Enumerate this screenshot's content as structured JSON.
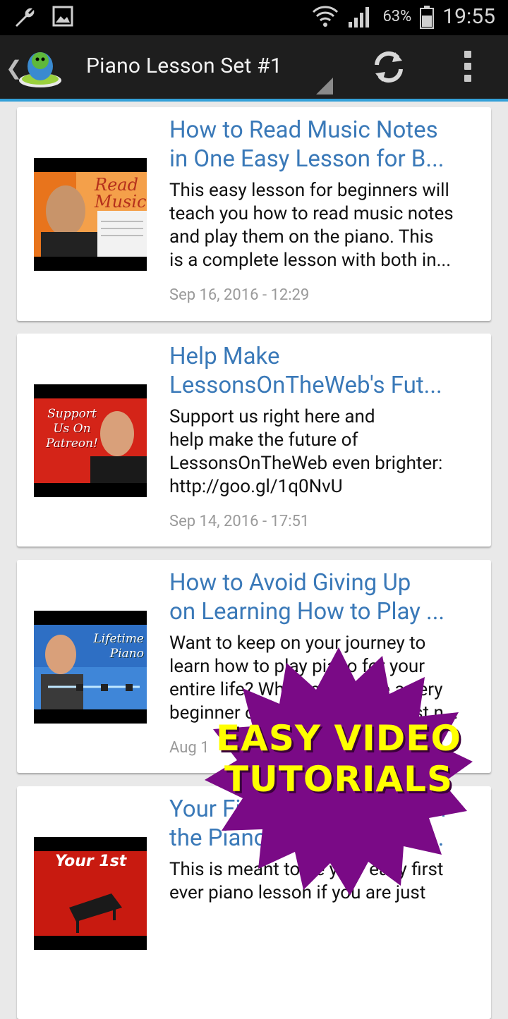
{
  "status_bar": {
    "battery_percent": "63%",
    "time": "19:55",
    "icons": [
      "wrench-icon",
      "image-icon",
      "wifi-icon",
      "signal-icon",
      "battery-icon"
    ]
  },
  "action_bar": {
    "title": "Piano Lesson Set #1",
    "icons": [
      "back-icon",
      "app-logo-icon",
      "refresh-icon",
      "overflow-menu-icon"
    ]
  },
  "feed": {
    "items": [
      {
        "title": "How to Read Music Notes in One Easy Lesson for B...",
        "title_l1": "How to Read Music Notes",
        "title_l2": "in One Easy Lesson for B...",
        "desc_l1": "This easy lesson for beginners will",
        "desc_l2": "teach you how to read music notes",
        "desc_l3": "and play them on the piano.  This",
        "desc_l4": "is a complete lesson with both in...",
        "date": "Sep 16, 2016 - 12:29",
        "thumb_text": "Read Music"
      },
      {
        "title_l1": "Help Make",
        "title_l2": "LessonsOnTheWeb's Fut...",
        "desc_l1": "Support us right here and",
        "desc_l2": "help make the future of",
        "desc_l3": "LessonsOnTheWeb even brighter:",
        "desc_l4": "http://goo.gl/1q0NvU",
        "date": "Sep 14, 2016 - 17:51",
        "thumb_text": "Support Us On Patreon!"
      },
      {
        "title_l1": "How to Avoid Giving Up",
        "title_l2": "on Learning How to Play ...",
        "desc_l1": "Want to keep on your journey to",
        "desc_l2": "learn how to play piano for your",
        "desc_l3": "entire life? Whether you are a very",
        "desc_l4": "beginner or an advanced pianist n...",
        "date": "Aug 1",
        "thumb_text": "Lifetime Piano"
      },
      {
        "title_l1": "Your First Piano Lesson on",
        "title_l2": "the Piano - Free Video Le...",
        "desc_l1": "This is meant to be your easy first",
        "desc_l2": "ever piano lesson if you are just",
        "thumb_text": "Your 1st"
      }
    ]
  },
  "badge": {
    "line1": "EASY VIDEO",
    "line2": "TUTORIALS"
  }
}
